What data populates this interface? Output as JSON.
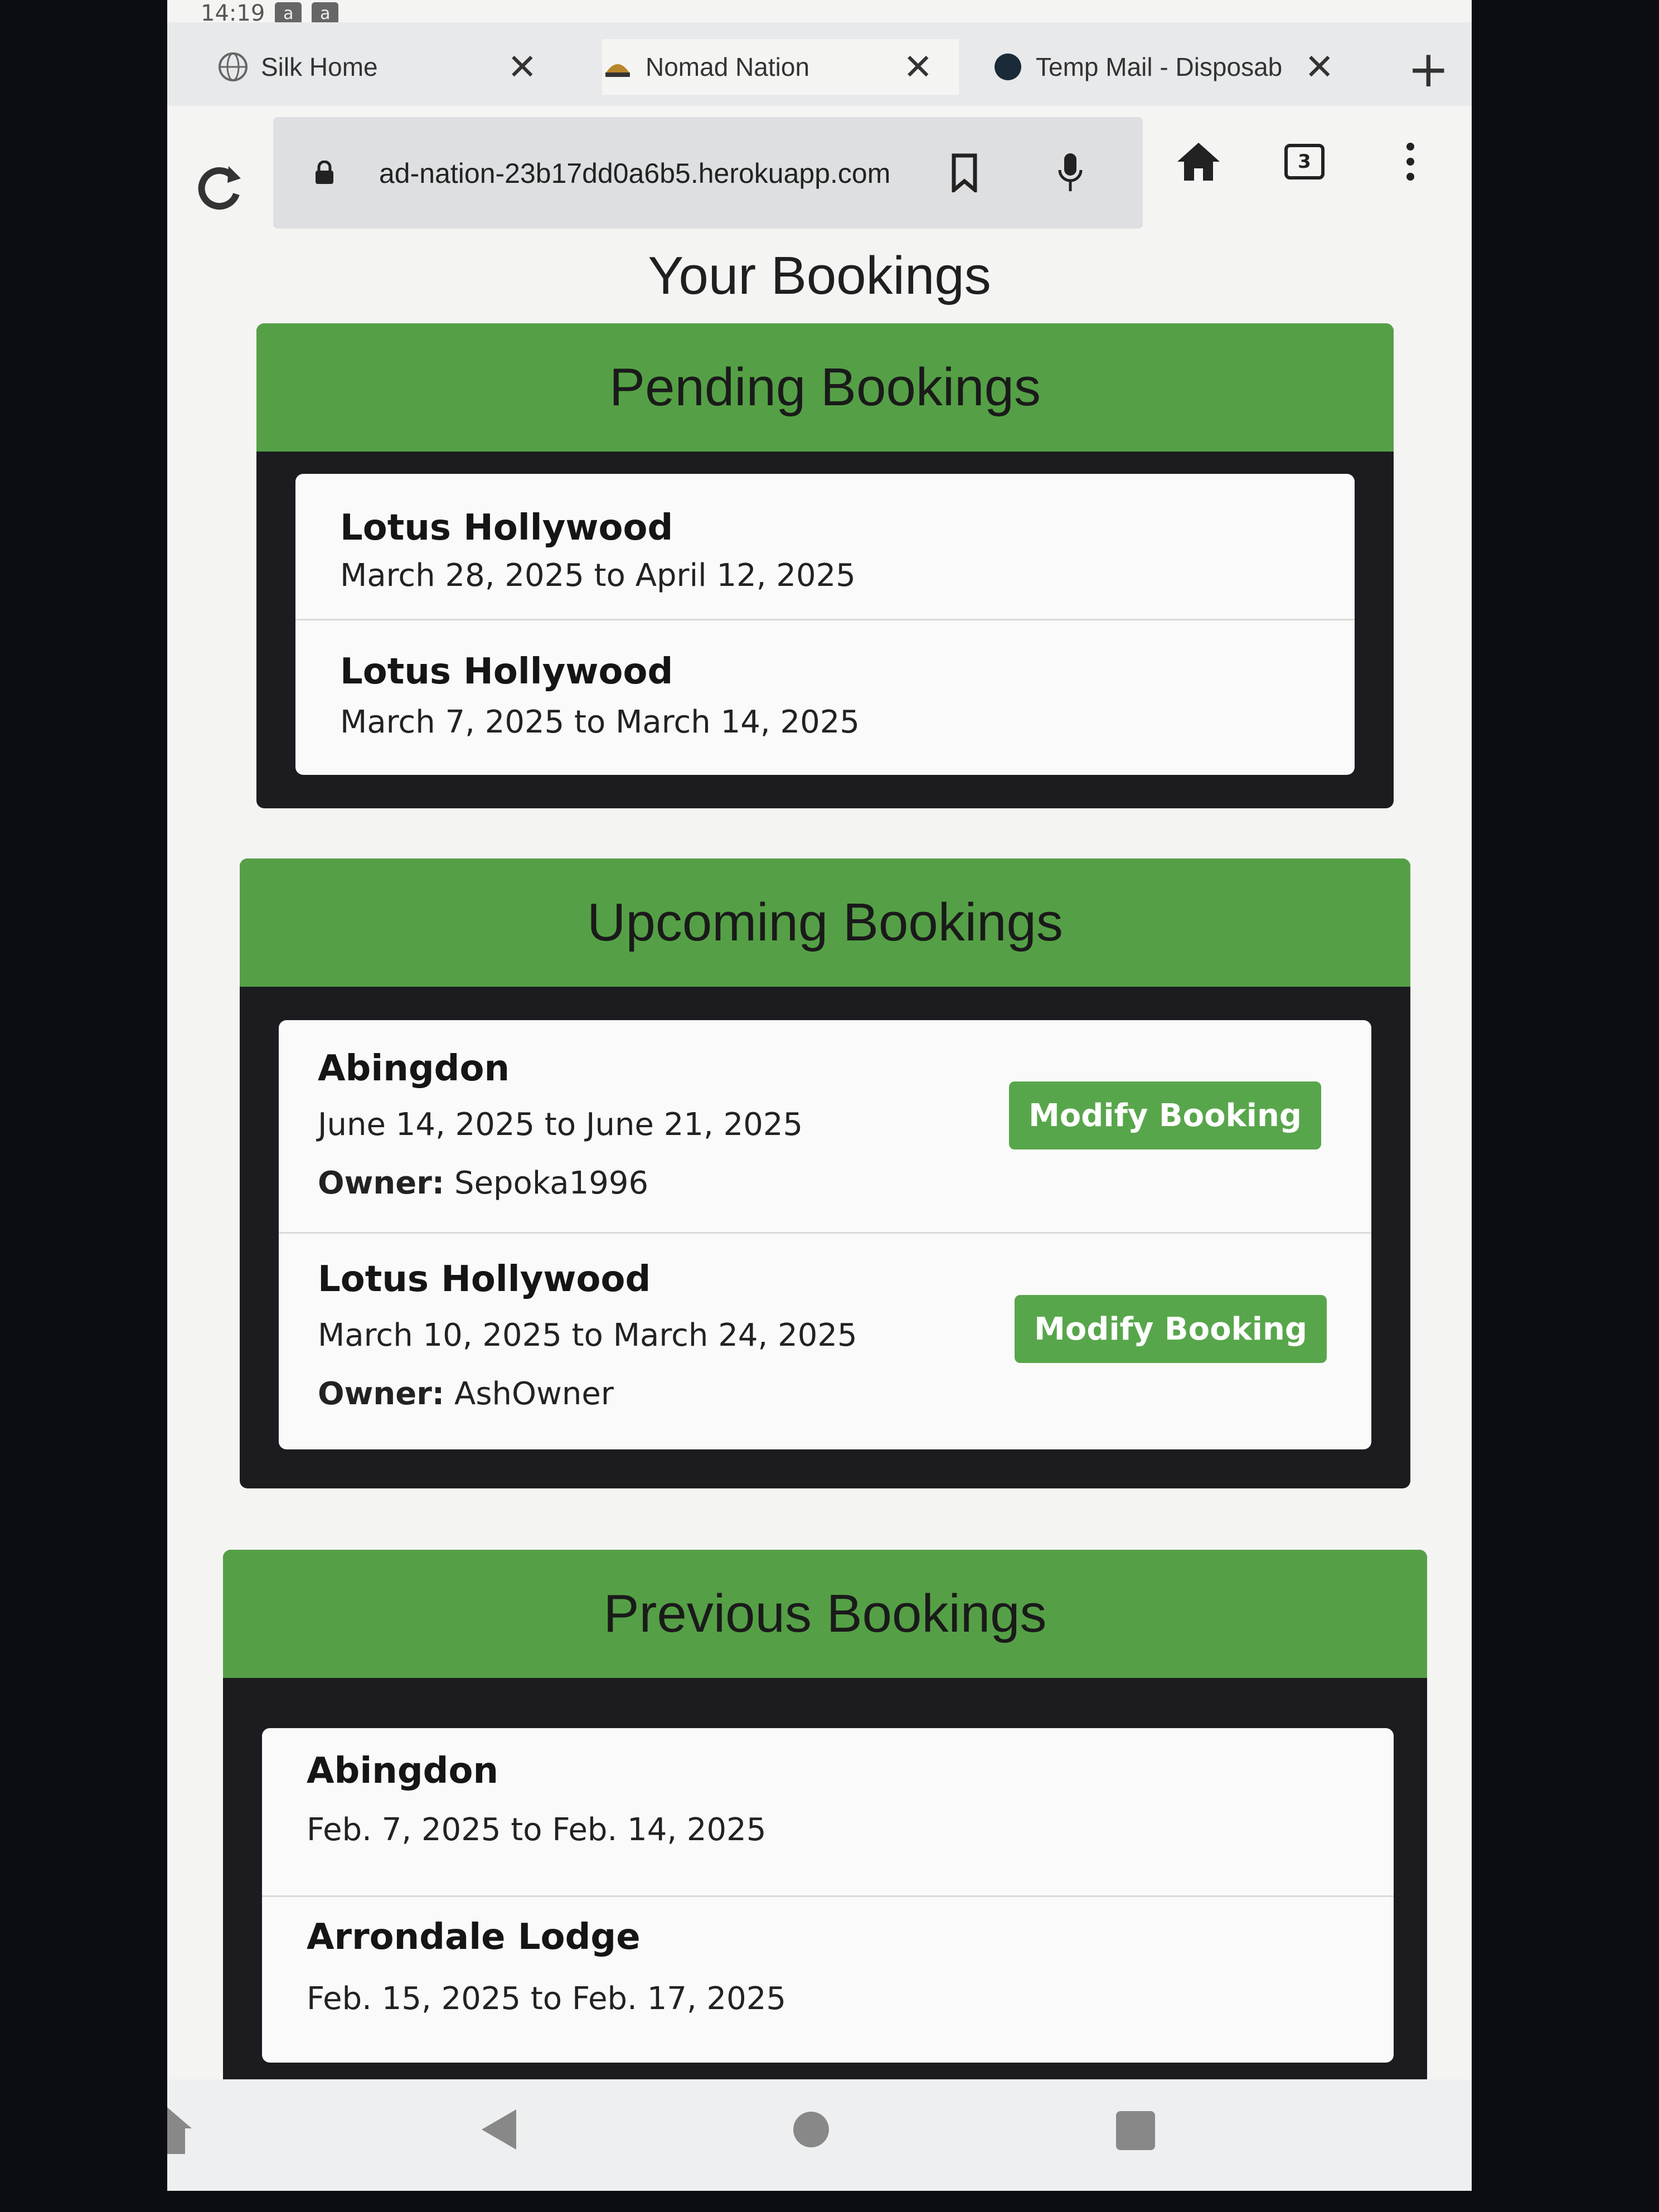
{
  "status_bar": {
    "time": "14:19",
    "badge_a": "a",
    "badge_b": "a"
  },
  "tabs": [
    {
      "title": "Silk Home",
      "close": "✕"
    },
    {
      "title": "Nomad Nation",
      "close": "✕"
    },
    {
      "title": "Temp Mail - Disposab",
      "close": "✕"
    }
  ],
  "toolbar": {
    "url": "ad-nation-23b17dd0a6b5.herokuapp.com",
    "tabs_count": "3",
    "new_tab": "+"
  },
  "page": {
    "title": "Your Bookings",
    "pending": {
      "header": "Pending Bookings",
      "items": [
        {
          "name": "Lotus Hollywood",
          "dates": "March 28, 2025 to April 12, 2025"
        },
        {
          "name": "Lotus Hollywood",
          "dates": "March 7, 2025 to March 14, 2025"
        }
      ]
    },
    "upcoming": {
      "header": "Upcoming Bookings",
      "items": [
        {
          "name": "Abingdon",
          "dates": "June 14, 2025 to June 21, 2025",
          "owner_label": "Owner:",
          "owner": "Sepoka1996",
          "button": "Modify Booking"
        },
        {
          "name": "Lotus Hollywood",
          "dates": "March 10, 2025 to March 24, 2025",
          "owner_label": "Owner:",
          "owner": "AshOwner",
          "button": "Modify Booking"
        }
      ]
    },
    "previous": {
      "header": "Previous Bookings",
      "items": [
        {
          "name": "Abingdon",
          "dates": "Feb. 7, 2025 to Feb. 14, 2025"
        },
        {
          "name": "Arrondale Lodge",
          "dates": "Feb. 15, 2025 to Feb. 17, 2025"
        }
      ]
    }
  },
  "colors": {
    "accent_green": "#55a046",
    "button_green": "#58a64b",
    "section_dark": "#1c1c20"
  },
  "icons": [
    "globe-icon",
    "nomad-icon",
    "tempmail-icon",
    "close-icon",
    "plus-icon",
    "reload-icon",
    "lock-icon",
    "bookmark-icon",
    "mic-icon",
    "home-icon",
    "tabs-icon",
    "more-icon",
    "back-icon",
    "home-circle-icon",
    "recents-icon",
    "silk-home-icon"
  ]
}
